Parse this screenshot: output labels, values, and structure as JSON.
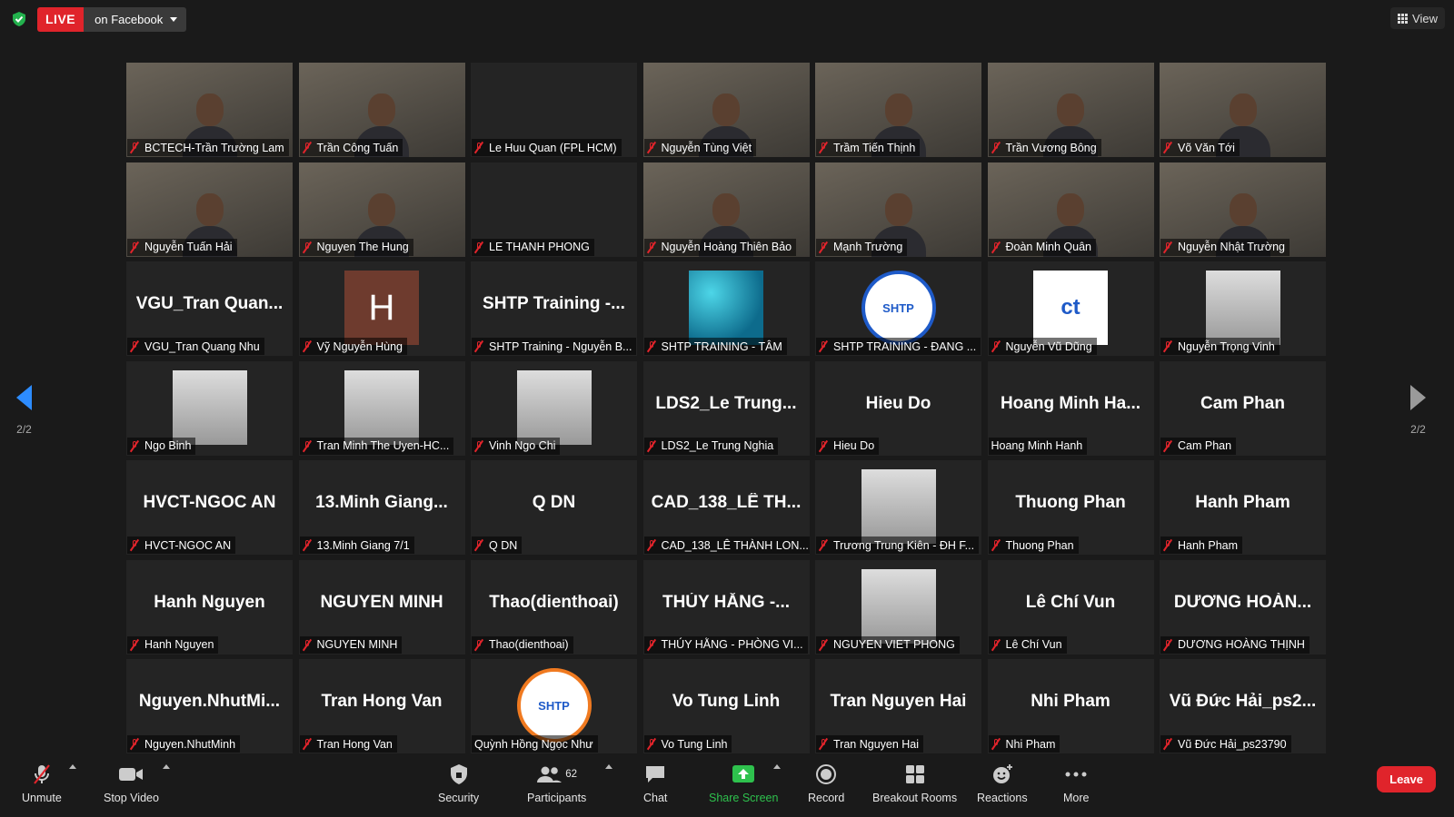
{
  "topbar": {
    "live_label": "LIVE",
    "destination": "on Facebook",
    "view_label": "View"
  },
  "pager": {
    "left_label": "2/2",
    "right_label": "2/2"
  },
  "participants": [
    {
      "name": "BCTECH-Trần Trường Lam",
      "kind": "video"
    },
    {
      "name": "Trần Công Tuấn",
      "kind": "video"
    },
    {
      "name": "Le Huu Quan (FPL HCM)",
      "kind": "blank"
    },
    {
      "name": "Nguyễn Tùng Việt",
      "kind": "video"
    },
    {
      "name": "Trầm Tiến Thịnh",
      "kind": "video"
    },
    {
      "name": "Trần Vương Bông",
      "kind": "video"
    },
    {
      "name": "Võ Văn Tới",
      "kind": "video"
    },
    {
      "name": "Nguyễn Tuấn Hải",
      "kind": "video"
    },
    {
      "name": "Nguyen The Hung",
      "kind": "video"
    },
    {
      "name": "LE THANH PHONG",
      "kind": "blank"
    },
    {
      "name": "Nguyễn Hoàng Thiên Bảo",
      "kind": "video"
    },
    {
      "name": "Mạnh Trường",
      "kind": "video"
    },
    {
      "name": "Đoàn Minh Quân",
      "kind": "video"
    },
    {
      "name": "Nguyễn Nhật Trường",
      "kind": "video"
    },
    {
      "name": "VGU_Tran Quang Nhu",
      "big": "VGU_Tran Quan...",
      "kind": "text"
    },
    {
      "name": "Vỹ Nguyễn Hùng",
      "avatar": "H",
      "kind": "letter"
    },
    {
      "name": "SHTP Training - Nguyễn B...",
      "big": "SHTP Training -...",
      "kind": "text"
    },
    {
      "name": "SHTP TRAINING - TÂM",
      "kind": "pattern"
    },
    {
      "name": "SHTP TRAINING - ĐANG ...",
      "logo": "SHTP",
      "kind": "logo"
    },
    {
      "name": "Nguyễn Vũ Dũng",
      "logo": "ct",
      "kind": "square"
    },
    {
      "name": "Nguyễn Trọng Vinh",
      "kind": "photo"
    },
    {
      "name": "Ngo Binh",
      "kind": "photo"
    },
    {
      "name": "Tran Minh The Uyen-HC...",
      "kind": "photo"
    },
    {
      "name": "Vinh Ngo Chi",
      "kind": "photo"
    },
    {
      "name": "LDS2_Le Trung Nghia",
      "big": "LDS2_Le Trung...",
      "kind": "text"
    },
    {
      "name": "Hieu Do",
      "big": "Hieu Do",
      "kind": "text"
    },
    {
      "name": "Hoang Minh Hanh",
      "big": "Hoang Minh Ha...",
      "kind": "text",
      "unmuted": true
    },
    {
      "name": "Cam Phan",
      "big": "Cam Phan",
      "kind": "text"
    },
    {
      "name": "HVCT-NGOC AN",
      "big": "HVCT-NGOC AN",
      "kind": "text"
    },
    {
      "name": "13.Minh Giang 7/1",
      "big": "13.Minh Giang...",
      "kind": "text"
    },
    {
      "name": "Q DN",
      "big": "Q DN",
      "kind": "text"
    },
    {
      "name": "CAD_138_LÊ THÀNH LON...",
      "big": "CAD_138_LÊ TH...",
      "kind": "text"
    },
    {
      "name": "Trương Trung Kiên - ĐH F...",
      "kind": "photo"
    },
    {
      "name": "Thuong Phan",
      "big": "Thuong Phan",
      "kind": "text"
    },
    {
      "name": "Hanh Pham",
      "big": "Hanh Pham",
      "kind": "text"
    },
    {
      "name": "Hanh Nguyen",
      "big": "Hanh Nguyen",
      "kind": "text"
    },
    {
      "name": "NGUYEN MINH",
      "big": "NGUYEN MINH",
      "kind": "text"
    },
    {
      "name": "Thao(dienthoai)",
      "big": "Thao(dienthoai)",
      "kind": "text"
    },
    {
      "name": "THÚY HẰNG - PHÒNG VI...",
      "big": "THÚY HẰNG -...",
      "kind": "text"
    },
    {
      "name": "NGUYEN VIET PHONG",
      "kind": "photo"
    },
    {
      "name": "Lê Chí Vun",
      "big": "Lê Chí Vun",
      "kind": "text"
    },
    {
      "name": "DƯƠNG HOÀNG THỊNH",
      "big": "DƯƠNG HOÀN...",
      "kind": "text"
    },
    {
      "name": "Nguyen.NhutMinh",
      "big": "Nguyen.NhutMi...",
      "kind": "text"
    },
    {
      "name": "Tran Hong Van",
      "big": "Tran Hong Van",
      "kind": "text"
    },
    {
      "name": "Quỳnh Hồng Ngọc Như",
      "logo": "SHTP",
      "kind": "logo-orange",
      "unmuted": true
    },
    {
      "name": "Vo Tung Linh",
      "big": "Vo Tung Linh",
      "kind": "text"
    },
    {
      "name": "Tran Nguyen Hai",
      "big": "Tran Nguyen Hai",
      "kind": "text"
    },
    {
      "name": "Nhi Pham",
      "big": "Nhi Pham",
      "kind": "text"
    },
    {
      "name": "Vũ Đức Hải_ps23790",
      "big": "Vũ Đức Hải_ps2...",
      "kind": "text"
    }
  ],
  "toolbar": {
    "unmute": "Unmute",
    "stop_video": "Stop Video",
    "security": "Security",
    "participants": "Participants",
    "participants_count": "62",
    "chat": "Chat",
    "share_screen": "Share Screen",
    "record": "Record",
    "breakout_rooms": "Breakout Rooms",
    "reactions": "Reactions",
    "more": "More",
    "leave": "Leave"
  },
  "colors": {
    "live": "#e0242b",
    "accent": "#2d8cff",
    "share": "#2ec14d",
    "leave": "#e0242b"
  }
}
